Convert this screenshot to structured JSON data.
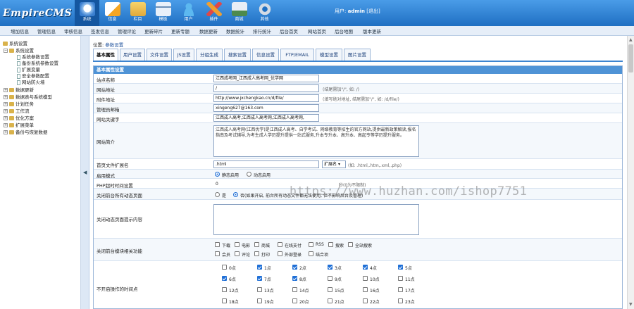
{
  "app": {
    "logo": "EmpireCMS"
  },
  "topnav": [
    {
      "label": "系统",
      "icon": "system-icon",
      "color": "#ffffff"
    },
    {
      "label": "信息",
      "icon": "info-icon",
      "color": "#f5a623"
    },
    {
      "label": "栏目",
      "icon": "column-icon",
      "color": "#f6d36b"
    },
    {
      "label": "模板",
      "icon": "template-icon",
      "color": "#d9e6f5"
    },
    {
      "label": "用户",
      "icon": "user-icon",
      "color": "#5cb8f0"
    },
    {
      "label": "插件",
      "icon": "plugin-icon",
      "color": "#f0a030"
    },
    {
      "label": "商城",
      "icon": "shop-icon",
      "color": "#e8eef6"
    },
    {
      "label": "其他",
      "icon": "other-icon",
      "color": "#d4dbe4"
    }
  ],
  "userbar": {
    "prefix": "用户:",
    "username": "admin",
    "logout": "[退出]"
  },
  "subnav": [
    "增加信息",
    "管理信息",
    "审核信息",
    "签发信息",
    "管理评论",
    "更新碎片",
    "更新专题",
    "数据更新",
    "数据统计",
    "排行统计",
    "后台首页",
    "网站首页",
    "后台地图",
    "版本更新"
  ],
  "tree": {
    "root": "系统设置",
    "children": [
      "系统设置",
      "系统参数设置",
      "备份系统参数设置",
      "扩展变量",
      "安全参数配置",
      "网站防火墙"
    ],
    "sections": [
      "数据更新",
      "数据表与系统模型",
      "计划任务",
      "工作流",
      "优化方案",
      "扩展菜单",
      "备份与恢复数据"
    ]
  },
  "splitter_arrow": "◀",
  "breadcrumb": {
    "prefix": "位置:",
    "link": "参数设置"
  },
  "tabs": [
    "基本属性",
    "用户设置",
    "文件设置",
    "JS设置",
    "分组生成",
    "搜索设置",
    "信息设置",
    "FTP/EMAIL",
    "模型设置",
    "图片设置"
  ],
  "section_title": "基本属性设置",
  "fields": {
    "site_name": {
      "label": "站点名称",
      "value": "江西成考网_江西成人高考网_优学网"
    },
    "site_url": {
      "label": "网站地址",
      "value": "/",
      "hint": "(结尾需加\"/\", 如: /)"
    },
    "attach_url": {
      "label": "附件地址",
      "value": "http://www.jxchengkao.cn/d/file/",
      "hint": "(填写绝对地址, 结尾需加\"/\", 如: /d/file/)"
    },
    "admin_email": {
      "label": "管理员邮箱",
      "value": "xingeng627@163.com"
    },
    "keywords": {
      "label": "网站关键字",
      "value": "江西成人高考,江西成人高考网,江西成人高考网,"
    },
    "description": {
      "label": "网站简介",
      "value": "江西成人高考网(江西优学)是江西成人高考、自学考试、网络教育等招生的官方网站,提供最新政策解读,报名指南及考试辅导,为考生成人学历提升提供一站式服务,升本专升本、高升本、高起专等学历提升服务。"
    },
    "file_ext": {
      "label": "首页文件扩展名",
      "value": ".html",
      "select": "扩展名",
      "hint": "(如: .html,.htm,.xml,.php)"
    },
    "open_mode": {
      "label": "启用模式",
      "opt_on": "静态启用",
      "opt_off": "动态启用"
    },
    "php_time": {
      "label": "PHP超时时间设置",
      "value": "0",
      "hint": "秒(0为不限制)"
    },
    "close_dynamic": {
      "label": "关闭前台所有动态页面",
      "opt_yes": "是",
      "opt_no": "否(如果开启, 前台所有动态文件都无法使用, 但不影响后台及管理)"
    },
    "close_msg": {
      "label": "关闭动态页面提示内容",
      "value": ""
    },
    "close_modules": {
      "label": "关闭前台模块相关功能",
      "options": [
        "下载",
        "电影",
        "商城",
        "在线支付",
        "RSS",
        "搜索",
        "全站搜索",
        "会员",
        "评论",
        "打印",
        "外部登录",
        "结合项"
      ]
    },
    "close_hours": {
      "label": "不开启操作的时间点",
      "hours": [
        "0点",
        "1点",
        "2点",
        "3点",
        "4点",
        "5点",
        "6点",
        "7点",
        "8点",
        "9点",
        "10点",
        "11点",
        "12点",
        "13点",
        "14点",
        "15点",
        "16点",
        "17点",
        "18点",
        "19点",
        "20点",
        "21点",
        "22点",
        "23点"
      ],
      "checked": [
        1,
        2,
        3,
        4,
        5,
        6,
        7,
        8
      ]
    }
  },
  "watermark": "https://www.huzhan.com/ishop7751"
}
